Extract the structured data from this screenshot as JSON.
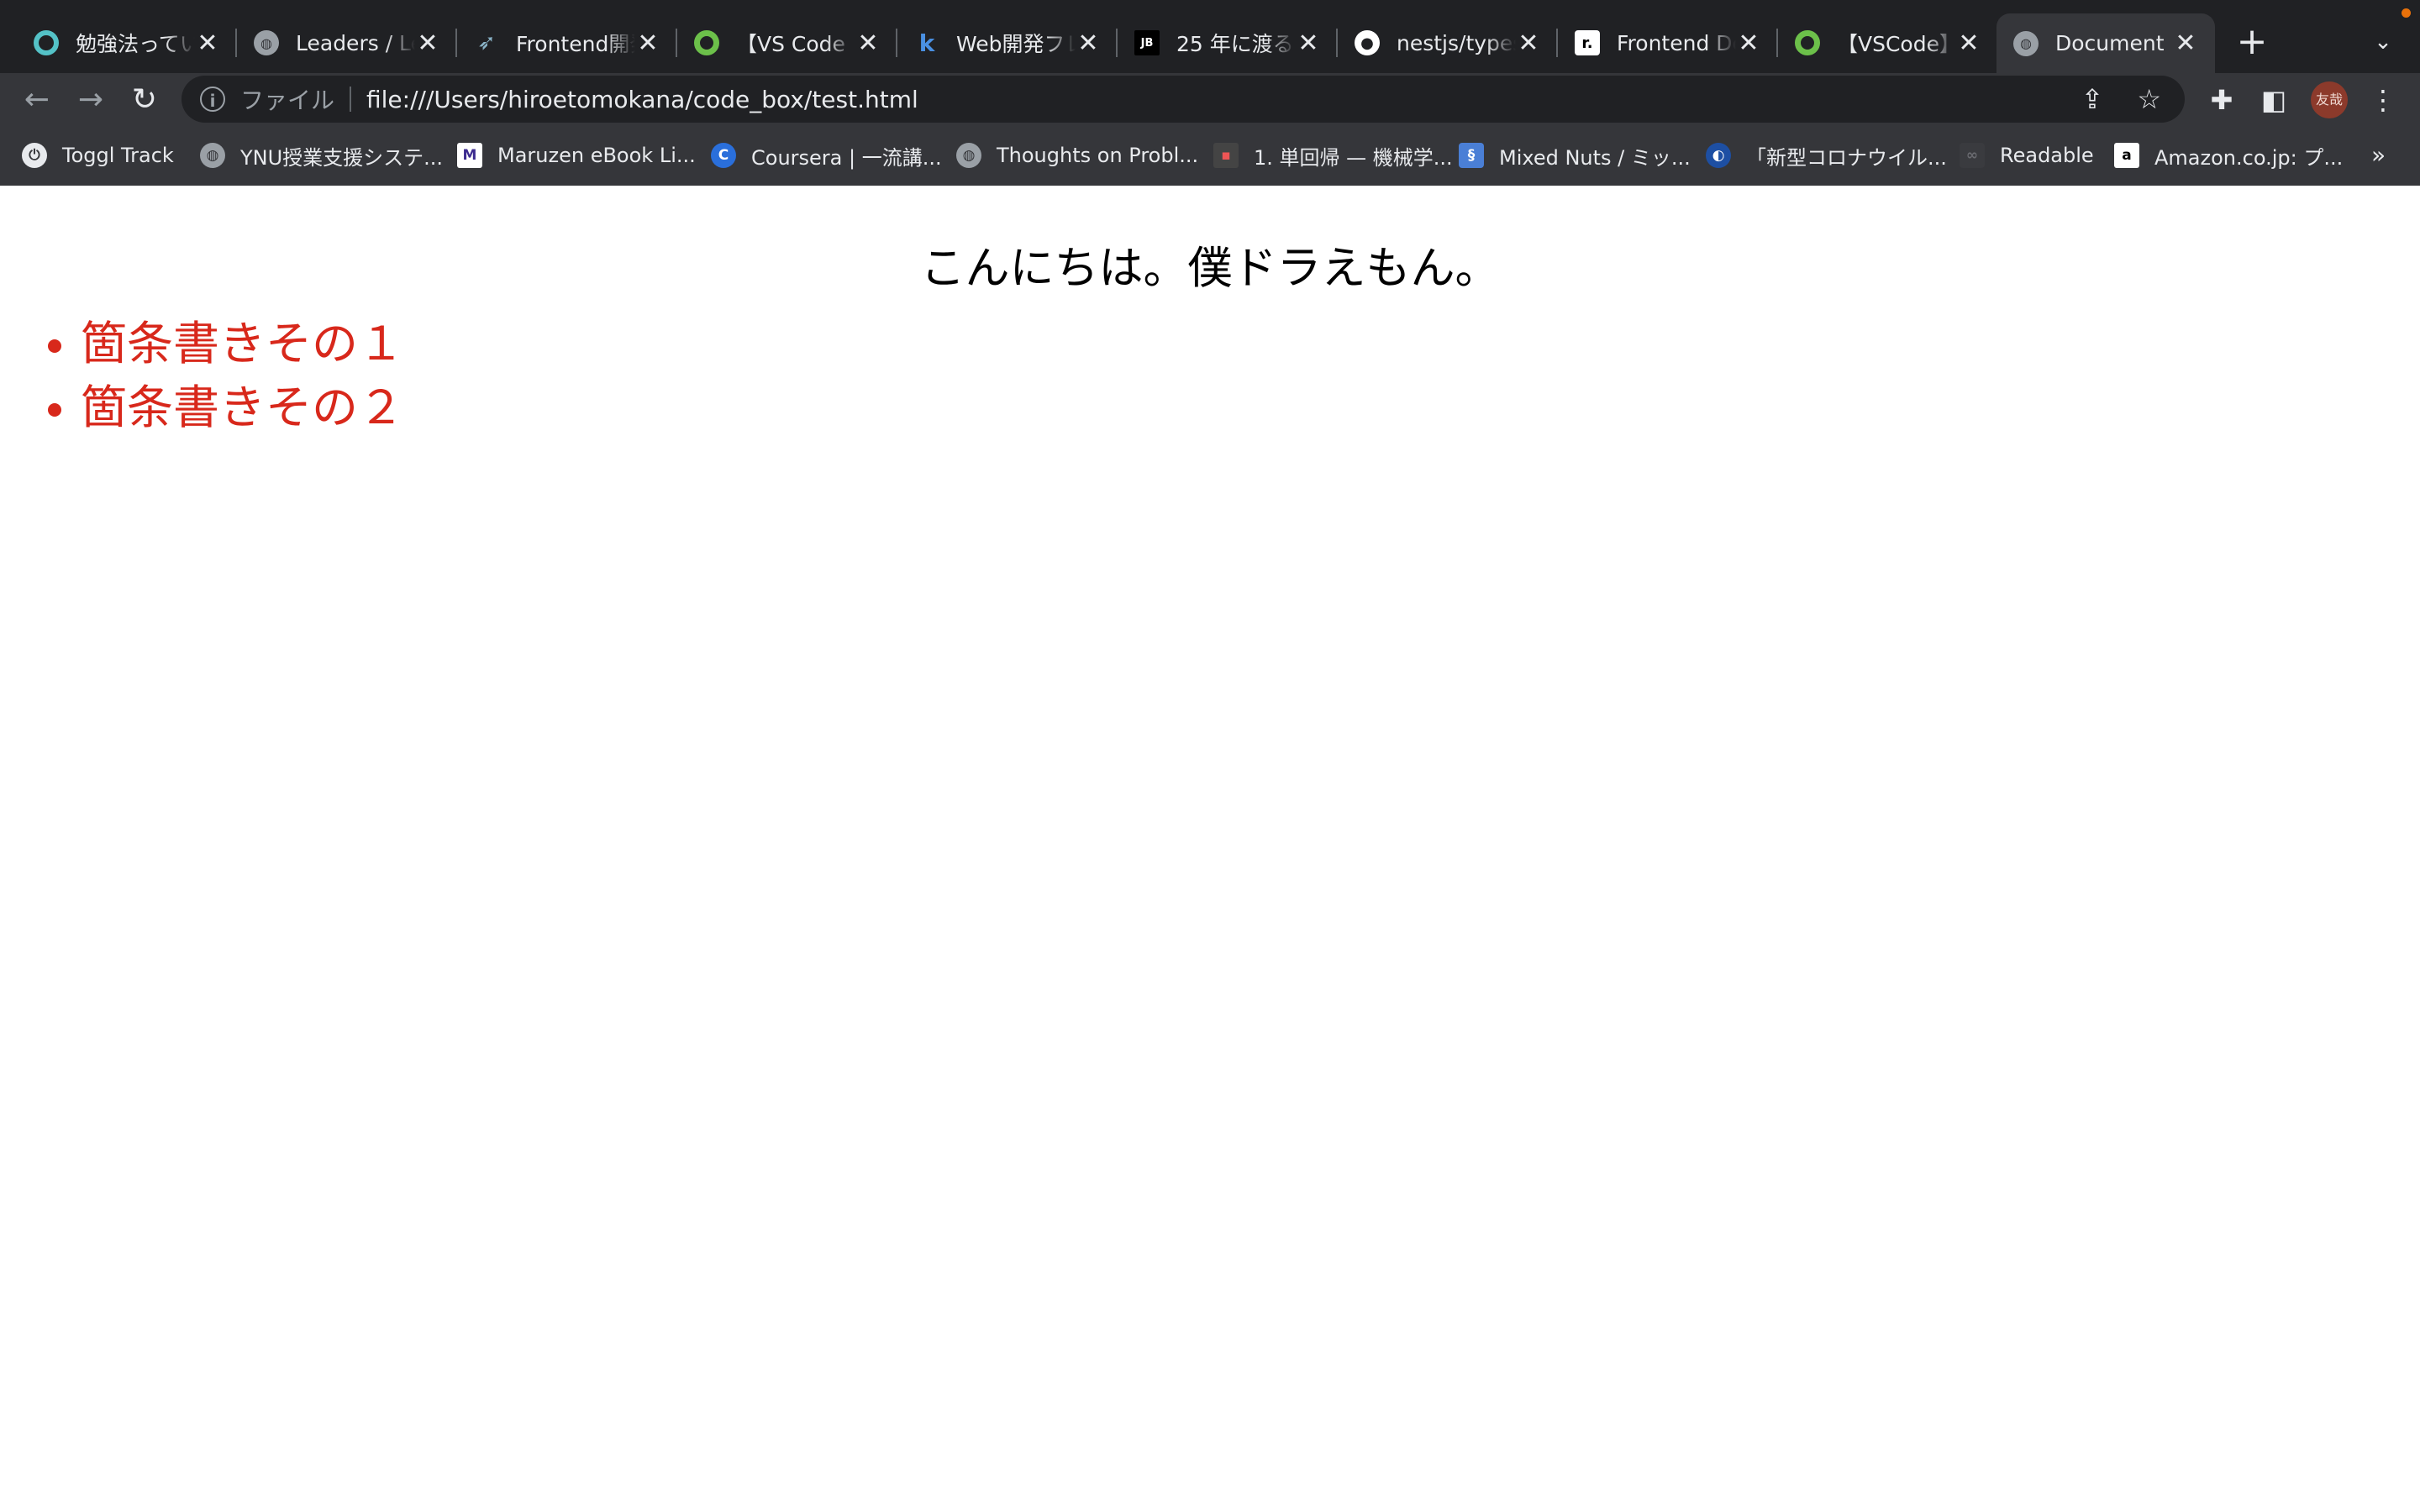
{
  "browser": {
    "tabs": [
      {
        "title": "勉強法ってい",
        "icon": "toggl-circle-icon"
      },
      {
        "title": "Leaders / Le",
        "icon": "globe-icon"
      },
      {
        "title": "Frontend開発",
        "icon": "bird-icon"
      },
      {
        "title": "【VS Code",
        "icon": "green-circle-icon"
      },
      {
        "title": "Web開発フレ",
        "icon": "k-logo-icon"
      },
      {
        "title": "25 年に渡る",
        "icon": "jetbrains-icon"
      },
      {
        "title": "nestjs/types",
        "icon": "github-icon"
      },
      {
        "title": "Frontend De",
        "icon": "r-logo-icon"
      },
      {
        "title": "【VSCode】",
        "icon": "green-circle-icon"
      },
      {
        "title": "Document",
        "icon": "globe-icon",
        "active": true
      }
    ],
    "address": {
      "scheme_label": "ファイル",
      "url": "file:///Users/hiroetomokana/code_box/test.html"
    },
    "profile_label": "友哉",
    "bookmarks": [
      {
        "label": "Toggl Track"
      },
      {
        "label": "YNU授業支援システ..."
      },
      {
        "label": "Maruzen eBook Li..."
      },
      {
        "label": "Coursera | 一流講..."
      },
      {
        "label": "Thoughts on Probl..."
      },
      {
        "label": "1. 単回帰 — 機械学..."
      },
      {
        "label": "Mixed Nuts / ミッ..."
      },
      {
        "label": "「新型コロナウイル..."
      },
      {
        "label": "Readable"
      },
      {
        "label": "Amazon.co.jp: プ..."
      }
    ],
    "bookmarks_more": "»"
  },
  "page": {
    "heading": "こんにちは。僕ドラえもん。",
    "list_items": [
      "箇条書きその１",
      "箇条書きその２"
    ],
    "list_color": "#d8281b"
  }
}
